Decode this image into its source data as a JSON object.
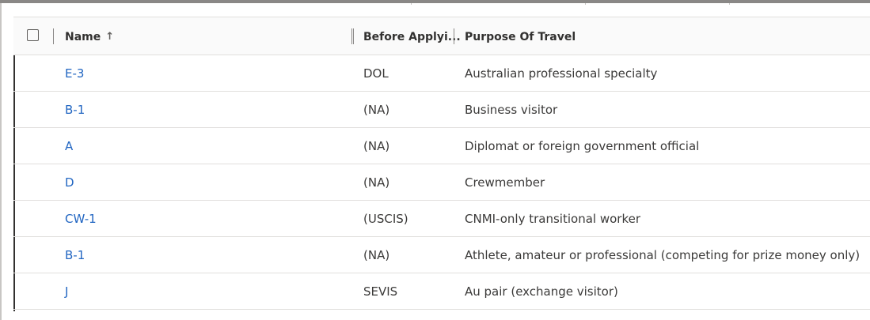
{
  "header": {
    "name_label": "Name",
    "before_label": "Before Applyi...",
    "purpose_label": "Purpose Of Travel",
    "sort_icon": "arrow-up-icon"
  },
  "rows": [
    {
      "name": "E-3",
      "before": "DOL",
      "purpose": "Australian professional specialty"
    },
    {
      "name": "B-1",
      "before": "(NA)",
      "purpose": "Business visitor"
    },
    {
      "name": "A",
      "before": "(NA)",
      "purpose": "Diplomat or foreign government official"
    },
    {
      "name": "D",
      "before": "(NA)",
      "purpose": "Crewmember"
    },
    {
      "name": "CW-1",
      "before": "(USCIS)",
      "purpose": "CNMI-only transitional worker"
    },
    {
      "name": "B-1",
      "before": "(NA)",
      "purpose": "Athlete, amateur or professional (competing for prize money only)"
    },
    {
      "name": "J",
      "before": "SEVIS",
      "purpose": "Au pair (exchange visitor)"
    }
  ],
  "colors": {
    "link": "#2266c2",
    "text": "#3b3a39",
    "border": "#e1dfdd"
  }
}
